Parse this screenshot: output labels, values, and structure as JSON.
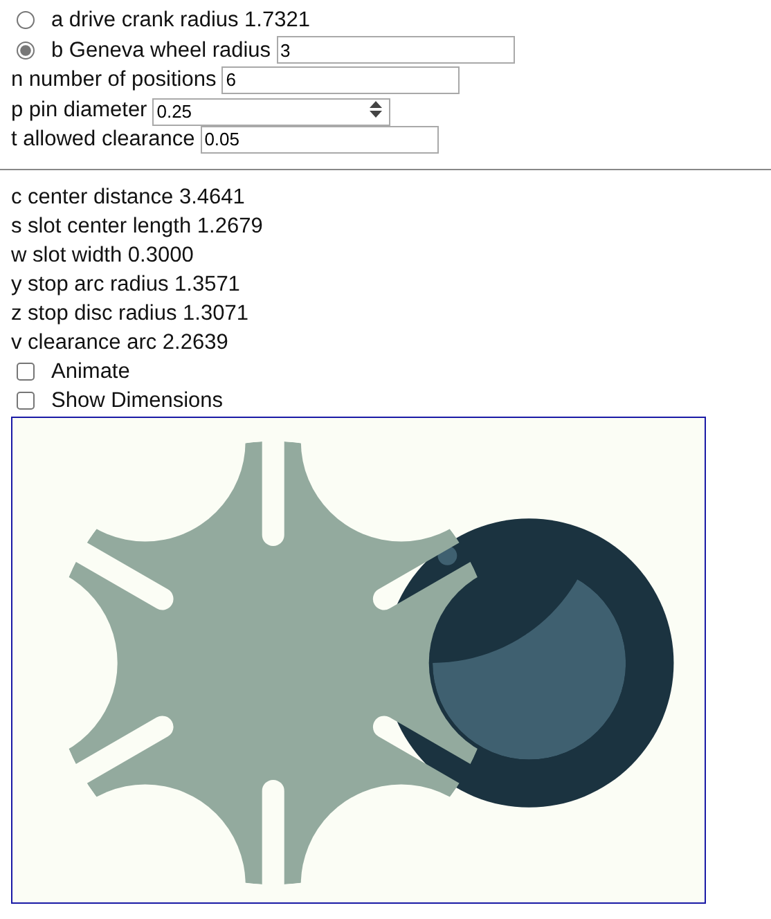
{
  "radios": [
    {
      "label": "a drive crank radius 1.7321",
      "selected": false
    },
    {
      "label": "b Geneva wheel radius",
      "selected": true,
      "value": "3"
    }
  ],
  "inputs": [
    {
      "label": "n number of positions",
      "value": "6",
      "kind": "text"
    },
    {
      "label": "p pin diameter",
      "value": "0.25",
      "kind": "number"
    },
    {
      "label": "t allowed clearance",
      "value": "0.05",
      "kind": "text"
    }
  ],
  "results": [
    "c center distance 3.4641",
    "s slot center length 1.2679",
    "w slot width 0.3000",
    "y stop arc radius 1.3571",
    "z stop disc radius 1.3071",
    "v clearance arc 2.2639"
  ],
  "checkboxes": [
    {
      "label": "Animate",
      "checked": false
    },
    {
      "label": "Show Dimensions",
      "checked": false
    }
  ]
}
